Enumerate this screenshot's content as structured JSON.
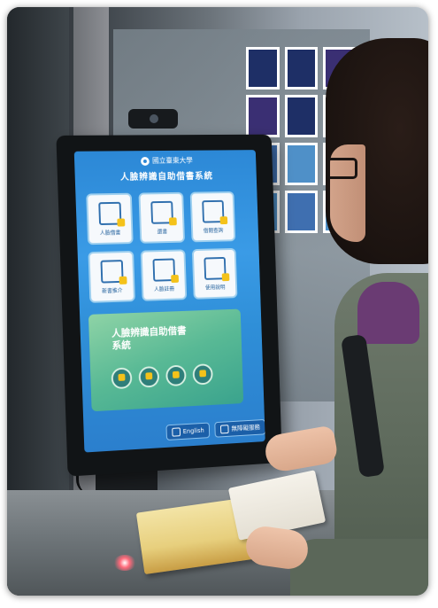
{
  "kiosk": {
    "logo_text": "國立臺東大學",
    "title": "人臉辨識自助借書系統",
    "tiles": [
      {
        "label": "人臉借書",
        "icon": "face-borrow-icon"
      },
      {
        "label": "還書",
        "icon": "return-book-icon"
      },
      {
        "label": "借閱查詢",
        "icon": "record-query-icon"
      },
      {
        "label": "新書推介",
        "icon": "new-book-icon"
      },
      {
        "label": "人臉註冊",
        "icon": "face-register-icon"
      },
      {
        "label": "使用說明",
        "icon": "guide-icon"
      }
    ],
    "banner_title": "人臉辨識自助借書系統",
    "banner_icons": [
      "face-scan-icon",
      "book-scan-icon",
      "transfer-icon",
      "camera-icon"
    ],
    "footer": {
      "english_label": "English",
      "accessibility_label": "無障礙服務"
    }
  },
  "colors": {
    "screen_blue": "#2c88d6",
    "tile_white": "#f6f9fc",
    "banner_green": "#58b995",
    "accent_yellow": "#f4c21a"
  }
}
